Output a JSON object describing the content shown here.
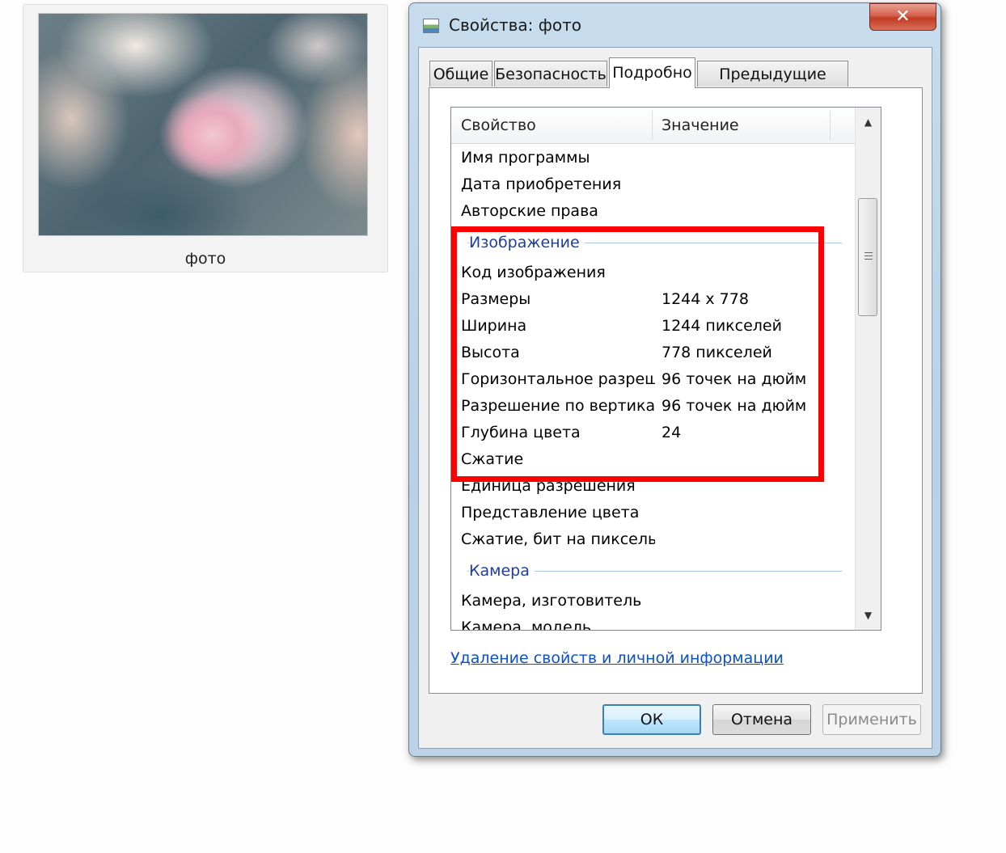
{
  "thumbnail": {
    "caption": "фото"
  },
  "dialog": {
    "title": "Свойства: фото",
    "close_glyph": "✕",
    "tabs": [
      {
        "label": "Общие"
      },
      {
        "label": "Безопасность"
      },
      {
        "label": "Подробно",
        "active": true
      },
      {
        "label": "Предыдущие версии"
      }
    ],
    "list": {
      "header_property": "Свойство",
      "header_value": "Значение",
      "rows_top": [
        {
          "k": "Имя программы",
          "v": ""
        },
        {
          "k": "Дата приобретения",
          "v": ""
        },
        {
          "k": "Авторские права",
          "v": ""
        }
      ],
      "group_image": "Изображение",
      "rows_image": [
        {
          "k": "Код изображения",
          "v": ""
        },
        {
          "k": "Размеры",
          "v": "1244 x 778"
        },
        {
          "k": "Ширина",
          "v": "1244 пикселей"
        },
        {
          "k": "Высота",
          "v": "778 пикселей"
        },
        {
          "k": "Горизонтальное разреше...",
          "v": "96 точек на дюйм"
        },
        {
          "k": "Разрешение по вертикали",
          "v": "96 точек на дюйм"
        },
        {
          "k": "Глубина цвета",
          "v": "24"
        },
        {
          "k": "Сжатие",
          "v": ""
        },
        {
          "k": "Единица разрешения",
          "v": ""
        },
        {
          "k": "Представление цвета",
          "v": ""
        },
        {
          "k": "Сжатие, бит на пиксель",
          "v": ""
        }
      ],
      "group_camera": "Камера",
      "rows_camera": [
        {
          "k": "Камера, изготовитель",
          "v": ""
        },
        {
          "k": "Камера, модель",
          "v": ""
        }
      ]
    },
    "remove_link": "Удаление свойств и личной информации",
    "buttons": {
      "ok": "ОК",
      "cancel": "Отмена",
      "apply": "Применить"
    },
    "colors": {
      "highlight": "#ff0000",
      "group_header": "#1e3d9e",
      "link": "#0b51c5"
    }
  }
}
